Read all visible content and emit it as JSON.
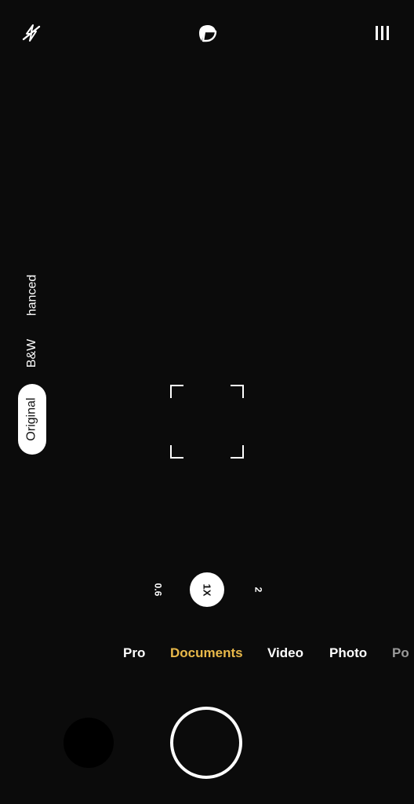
{
  "top_bar": {
    "flash_icon": "flash-off-icon",
    "lens_icon": "lens-switch-icon",
    "menu_icon": "menu-icon"
  },
  "filters": {
    "enhanced": "hanced",
    "bw": "B&W",
    "original": "Original",
    "selected": "Original"
  },
  "zoom": {
    "levels": [
      "0.6",
      "1X",
      "2"
    ],
    "selected": "1X"
  },
  "modes": {
    "items": [
      "Pro",
      "Documents",
      "Video",
      "Photo",
      "Po"
    ],
    "active": "Documents",
    "active_color": "#e9b94a"
  },
  "colors": {
    "background": "#0b0b0b",
    "accent": "#e9b94a"
  }
}
